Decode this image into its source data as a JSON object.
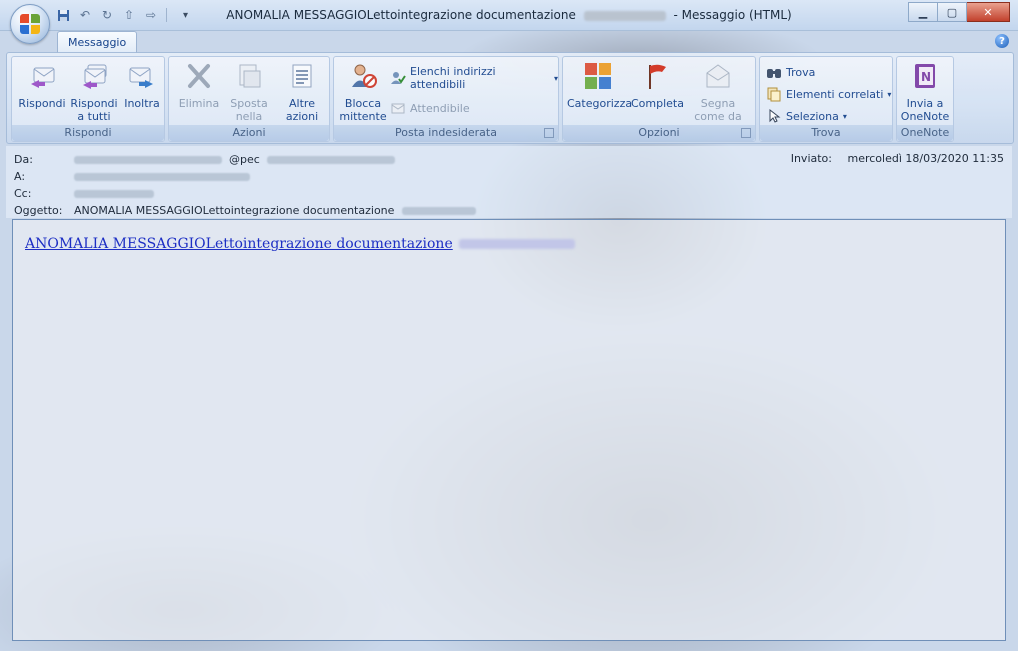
{
  "window": {
    "title": "ANOMALIA MESSAGGIOLettointegrazione documentazione",
    "title_suffix": "- Messaggio (HTML)"
  },
  "quick_access": {
    "items": [
      "save-icon",
      "undo-icon",
      "redo-icon",
      "up-icon",
      "down-icon"
    ]
  },
  "ribbon": {
    "tab": "Messaggio",
    "groups": {
      "rispondi": {
        "label": "Rispondi",
        "buttons": [
          "Rispondi",
          "Rispondi a tutti",
          "Inoltra"
        ]
      },
      "azioni": {
        "label": "Azioni",
        "buttons": [
          "Elimina",
          "Sposta nella cartella",
          "Altre azioni"
        ]
      },
      "posta": {
        "label": "Posta indesiderata",
        "big": "Blocca mittente",
        "small": [
          "Elenchi indirizzi attendibili",
          "Attendibile"
        ]
      },
      "opzioni": {
        "label": "Opzioni",
        "buttons": [
          "Categorizza",
          "Completa",
          "Segna come da leggere"
        ]
      },
      "trova": {
        "label": "Trova",
        "items": [
          "Trova",
          "Elementi correlati",
          "Seleziona"
        ]
      },
      "onenote": {
        "label": "OneNote",
        "button": "Invia a OneNote"
      }
    }
  },
  "header": {
    "from_label": "Da:",
    "from_value": "@pec",
    "to_label": "A:",
    "cc_label": "Cc:",
    "subject_label": "Oggetto:",
    "subject_value": "ANOMALIA MESSAGGIOLettointegrazione documentazione",
    "sent_label": "Inviato:",
    "sent_value": "mercoledì 18/03/2020 11:35"
  },
  "body": {
    "link_text": "ANOMALIA MESSAGGIOLettointegrazione documentazione"
  },
  "colors": {
    "accent": "#15428b",
    "link": "#1c2ec4",
    "ribbon_bg": "#d6e3f4"
  }
}
